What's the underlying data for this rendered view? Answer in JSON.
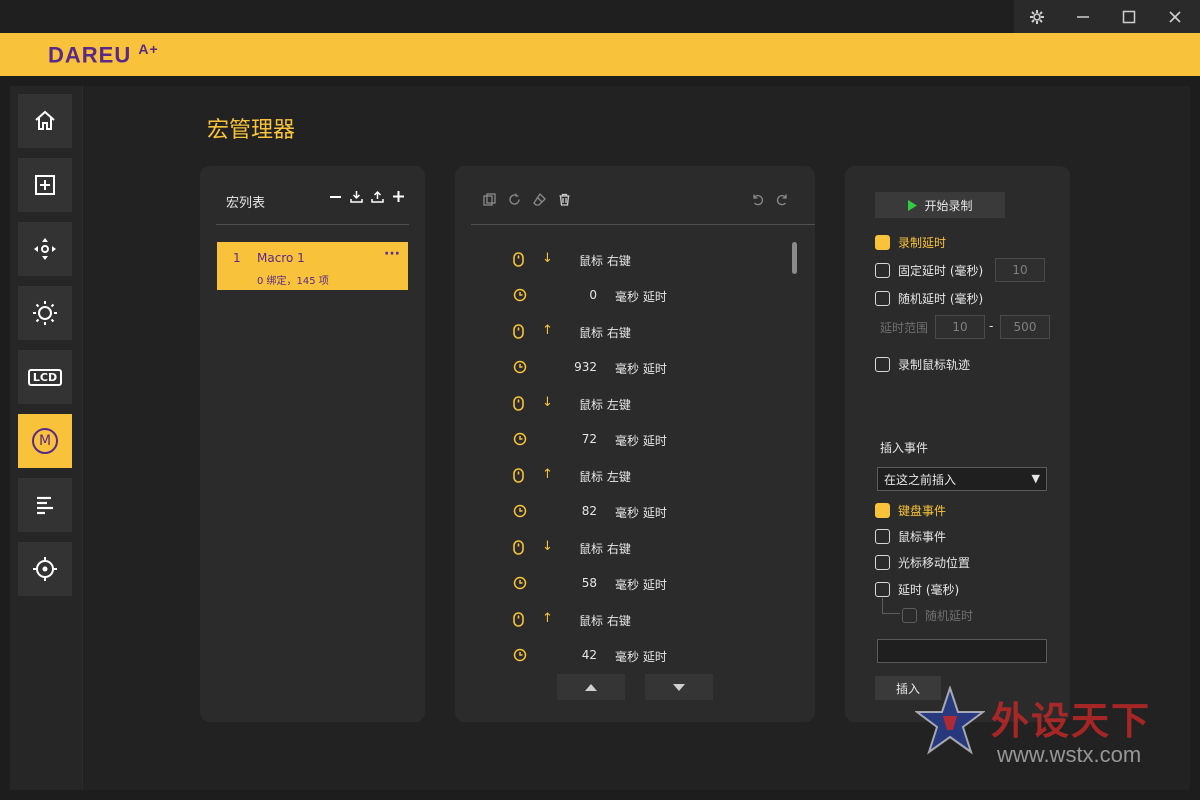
{
  "window": {
    "controls": [
      "gear-icon",
      "minimize-icon",
      "maximize-icon",
      "close-icon"
    ]
  },
  "brand": {
    "logo_text": "DAREU",
    "logo_suffix": "A+",
    "accent": "#f8c33a",
    "logo_color": "#5a2a8a"
  },
  "sidebar": {
    "items": [
      {
        "icon": "home-icon",
        "active": false
      },
      {
        "icon": "plus-box-icon",
        "active": false
      },
      {
        "icon": "dpad-icon",
        "active": false
      },
      {
        "icon": "brightness-icon",
        "active": false
      },
      {
        "icon": "lcd-icon",
        "label": "LCD",
        "active": false
      },
      {
        "icon": "macro-icon",
        "label": "M",
        "active": true
      },
      {
        "icon": "align-left-icon",
        "active": false
      },
      {
        "icon": "crosshair-icon",
        "active": false
      }
    ]
  },
  "page": {
    "title": "宏管理器"
  },
  "macro_list": {
    "header": "宏列表",
    "tools": [
      "minus-icon",
      "import-icon",
      "export-icon",
      "add-icon"
    ],
    "items": [
      {
        "num": "1",
        "name": "Macro 1",
        "sub": "0 绑定，145 项",
        "more": "···"
      }
    ]
  },
  "events": {
    "tools": [
      "copy-icon",
      "redo-icon",
      "eraser-icon",
      "trash-icon"
    ],
    "undo_tools": [
      "undo-icon",
      "redo-arrow-icon"
    ],
    "rows": [
      {
        "kind": "mouse",
        "dir": "↓",
        "label": "鼠标 右键"
      },
      {
        "kind": "delay",
        "value": "0",
        "unit": "毫秒 延时"
      },
      {
        "kind": "mouse",
        "dir": "↑",
        "label": "鼠标 右键"
      },
      {
        "kind": "delay",
        "value": "932",
        "unit": "毫秒 延时"
      },
      {
        "kind": "mouse",
        "dir": "↓",
        "label": "鼠标 左键"
      },
      {
        "kind": "delay",
        "value": "72",
        "unit": "毫秒 延时"
      },
      {
        "kind": "mouse",
        "dir": "↑",
        "label": "鼠标 左键"
      },
      {
        "kind": "delay",
        "value": "82",
        "unit": "毫秒 延时"
      },
      {
        "kind": "mouse",
        "dir": "↓",
        "label": "鼠标 右键"
      },
      {
        "kind": "delay",
        "value": "58",
        "unit": "毫秒 延时"
      },
      {
        "kind": "mouse",
        "dir": "↑",
        "label": "鼠标 右键"
      },
      {
        "kind": "delay",
        "value": "42",
        "unit": "毫秒 延时"
      }
    ]
  },
  "options": {
    "record_button": "开始录制",
    "record_delay": {
      "label": "录制延时",
      "checked": true
    },
    "fixed_delay": {
      "label": "固定延时 (毫秒)",
      "checked": false,
      "value": "10"
    },
    "random_delay": {
      "label": "随机延时 (毫秒)",
      "checked": false
    },
    "delay_range": {
      "label": "延时范围",
      "min": "10",
      "sep": "-",
      "max": "500"
    },
    "record_track": {
      "label": "录制鼠标轨迹",
      "checked": false
    },
    "insert_event": {
      "title": "插入事件",
      "position_selected": "在这之前插入",
      "keyboard": {
        "label": "键盘事件",
        "checked": true
      },
      "mouse": {
        "label": "鼠标事件",
        "checked": false
      },
      "cursor": {
        "label": "光标移动位置",
        "checked": false
      },
      "delay": {
        "label": "延时 (毫秒)",
        "checked": false
      },
      "random": {
        "label": "随机延时",
        "checked": false
      },
      "insert_button": "插入"
    }
  },
  "watermark": {
    "text": "外设天下",
    "url": "www.wstx.com"
  }
}
